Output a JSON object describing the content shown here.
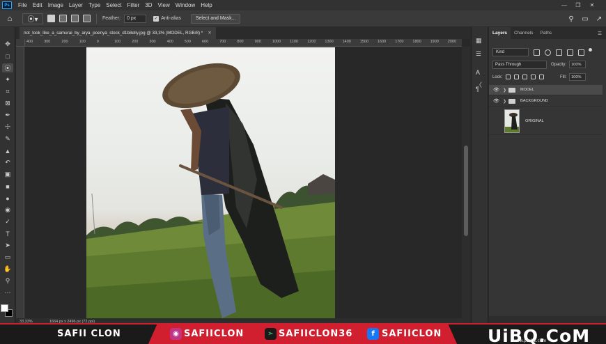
{
  "menubar": {
    "items": [
      "File",
      "Edit",
      "Image",
      "Layer",
      "Type",
      "Select",
      "Filter",
      "3D",
      "View",
      "Window",
      "Help"
    ],
    "logo": "Ps",
    "window_controls": [
      "—",
      "❐",
      "✕"
    ]
  },
  "options": {
    "feather_label": "Feather:",
    "feather_value": "0 px",
    "antialias_label": "Anti-alias",
    "antialias_checked": true,
    "mask_button": "Select and Mask..."
  },
  "document": {
    "tab_title": "not_look_like_a_samurai_by_arya_poenya_stock_d1b8elly.jpg @ 33,3% (MODEL, RGB/8) *",
    "zoom": "33,33%",
    "doc_size": "1664 px x 2496 px (72 ppi)"
  },
  "ruler": {
    "h_labels": [
      "400",
      "300",
      "200",
      "100",
      "0",
      "100",
      "200",
      "300",
      "400",
      "500",
      "600",
      "700",
      "800",
      "900",
      "1000",
      "1100",
      "1200",
      "1300",
      "1400",
      "1500",
      "1600",
      "1700",
      "1800",
      "1900",
      "2000"
    ]
  },
  "layers_panel": {
    "tabs": [
      "Layers",
      "Channels",
      "Paths"
    ],
    "kind_label": "Kind",
    "blend_mode": "Pass Through",
    "opacity_label": "Opacity:",
    "opacity_value": "100%",
    "lock_label": "Lock:",
    "fill_label": "Fill:",
    "fill_value": "100%",
    "layers": [
      {
        "name": "MODEL",
        "type": "group",
        "selected": true
      },
      {
        "name": "BACKGROUND",
        "type": "group",
        "selected": false
      },
      {
        "name": "ORIGINAL",
        "type": "image",
        "selected": false
      }
    ]
  },
  "banner": {
    "left_text": "SAFII CLON",
    "instagram": "SAFIICLON",
    "other_handle": "SAFIICLON36",
    "facebook": "SAFIICLON",
    "watermark": "UiBQ.CoM",
    "watermark_sub": "www.psahz.com",
    "accent_color": "#d21f2f"
  }
}
